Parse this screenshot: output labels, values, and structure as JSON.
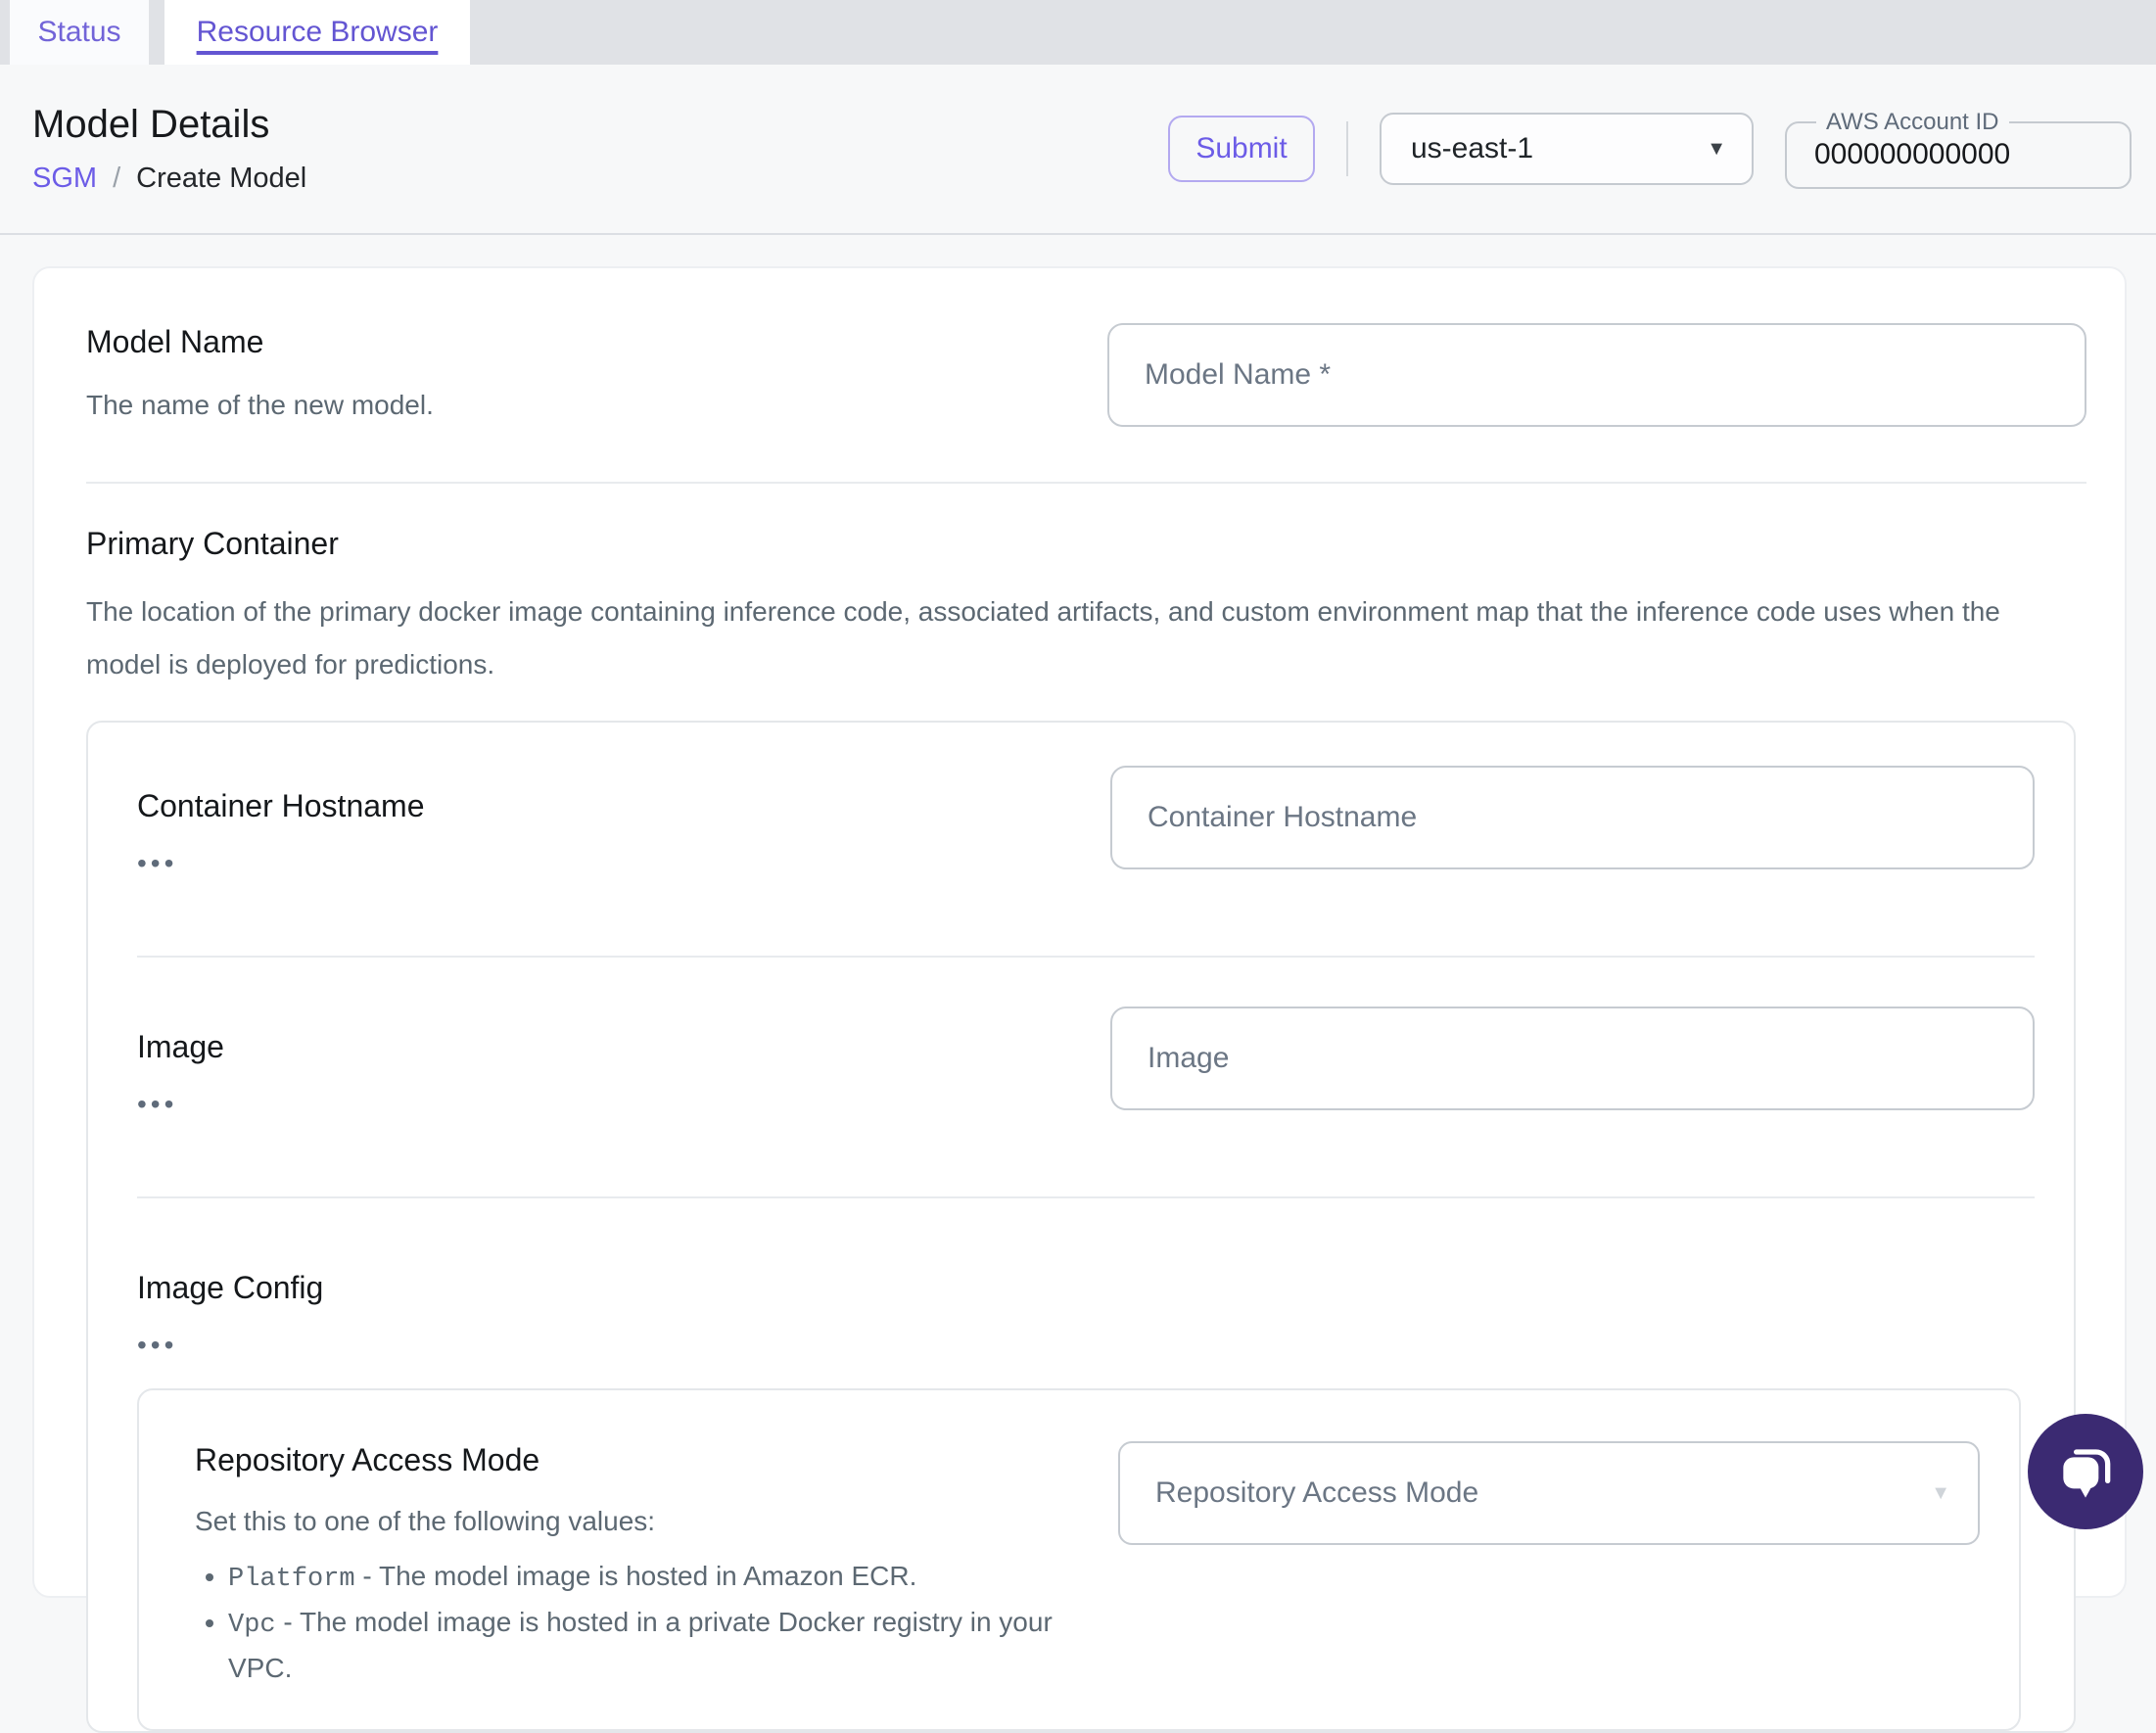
{
  "tabs": {
    "status": "Status",
    "resource_browser": "Resource Browser"
  },
  "header": {
    "title": "Model Details",
    "breadcrumb": {
      "root": "SGM",
      "separator": "/",
      "current": "Create Model"
    },
    "submit_label": "Submit",
    "region": {
      "value": "us-east-1"
    },
    "account": {
      "label": "AWS Account ID",
      "value": "000000000000"
    }
  },
  "form": {
    "model_name": {
      "label": "Model Name",
      "description": "The name of the new model.",
      "placeholder": "Model Name *"
    },
    "primary_container": {
      "label": "Primary Container",
      "description": "The location of the primary docker image containing inference code, associated artifacts, and custom environment map that the inference code uses when the model is deployed for predictions.",
      "container_hostname": {
        "label": "Container Hostname",
        "placeholder": "Container Hostname",
        "expander": "•••"
      },
      "image": {
        "label": "Image",
        "placeholder": "Image",
        "expander": "•••"
      },
      "image_config": {
        "label": "Image Config",
        "expander": "•••",
        "repository_access_mode": {
          "label": "Repository Access Mode",
          "placeholder": "Repository Access Mode",
          "description": "Set this to one of the following values:",
          "bullets": [
            {
              "term": "Platform",
              "text": " - The model image is hosted in Amazon ECR."
            },
            {
              "term": "Vpc",
              "text": " - The model image is hosted in a private Docker registry in your VPC."
            }
          ]
        }
      }
    }
  },
  "icons": {
    "region_dropdown_arrow": "▼",
    "select_dropdown_arrow": "▼"
  },
  "colors": {
    "accent_purple": "#6c5ce7",
    "chat_button_purple": "#3b2a72"
  }
}
